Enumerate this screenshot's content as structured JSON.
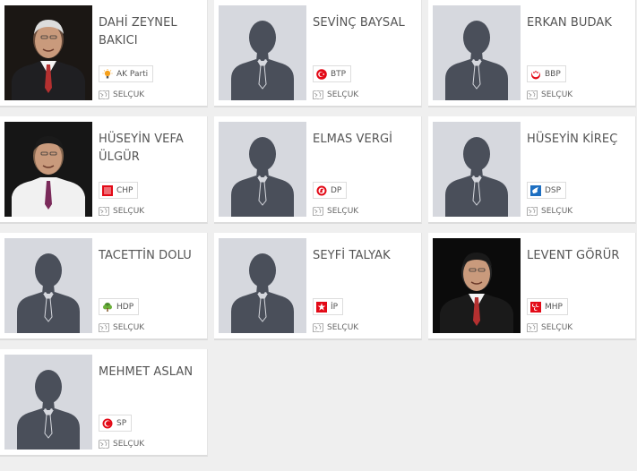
{
  "candidates": [
    {
      "name": "DAHİ ZEYNEL BAKICI",
      "party": "AK Parti",
      "party_icon": "lightbulb-icon",
      "party_color": "#f6a01a",
      "district": "SELÇUK",
      "photo": "real",
      "photo_tone": "#6b4e3d"
    },
    {
      "name": "SEVİNÇ BAYSAL",
      "party": "BTP",
      "party_icon": "crescent-star-circle-icon",
      "party_color": "#e30a17",
      "district": "SELÇUK",
      "photo": "placeholder"
    },
    {
      "name": "ERKAN BUDAK",
      "party": "BBP",
      "party_icon": "bbp-crescent-icon",
      "party_color": "#e30a17",
      "district": "SELÇUK",
      "photo": "placeholder"
    },
    {
      "name": "HÜSEYİN VEFA ÜLGÜR",
      "party": "CHP",
      "party_icon": "six-arrows-icon",
      "party_color": "#e30a17",
      "district": "SELÇUK",
      "photo": "real",
      "photo_tone": "#8a6a52"
    },
    {
      "name": "ELMAS VERGİ",
      "party": "DP",
      "party_icon": "horse-circle-icon",
      "party_color": "#e30a17",
      "district": "SELÇUK",
      "photo": "placeholder"
    },
    {
      "name": "HÜSEYİN KİREÇ",
      "party": "DSP",
      "party_icon": "dove-icon",
      "party_color": "#1e6fc1",
      "district": "SELÇUK",
      "photo": "placeholder"
    },
    {
      "name": "TACETTİN DOLU",
      "party": "HDP",
      "party_icon": "tree-icon",
      "party_color": "#4a8a2a",
      "district": "SELÇUK",
      "photo": "placeholder"
    },
    {
      "name": "SEYFİ TALYAK",
      "party": "İP",
      "party_icon": "star-icon",
      "party_color": "#e30a17",
      "district": "SELÇUK",
      "photo": "placeholder"
    },
    {
      "name": "LEVENT GÖRÜR",
      "party": "MHP",
      "party_icon": "three-crescents-icon",
      "party_color": "#e30a17",
      "district": "SELÇUK",
      "photo": "real",
      "photo_tone": "#2a2a2a"
    },
    {
      "name": "MEHMET ASLAN",
      "party": "SP",
      "party_icon": "sp-crescent-icon",
      "party_color": "#e30a17",
      "district": "SELÇUK",
      "photo": "placeholder"
    }
  ],
  "colors": {
    "placeholder_bg": "#d6d8de",
    "silhouette": "#4a4f5a"
  }
}
